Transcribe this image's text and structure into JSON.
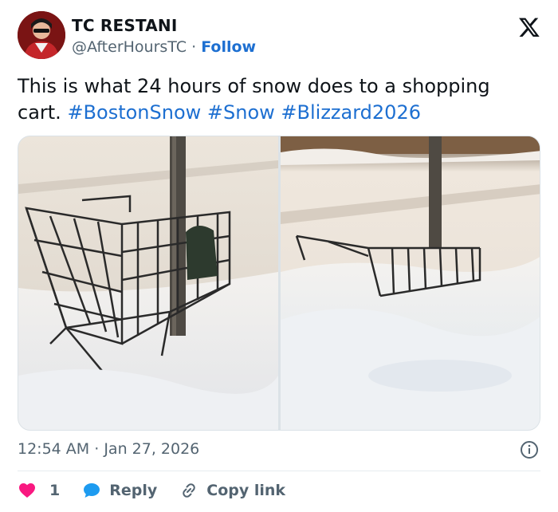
{
  "author": {
    "name": "TC RESTANI",
    "handle": "@AfterHoursTC",
    "separator": "·",
    "follow_label": "Follow"
  },
  "tweet": {
    "text": "This is what 24 hours of snow does to a shopping cart. ",
    "hashtags": [
      "#BostonSnow",
      "#Snow",
      "#Blizzard2026"
    ]
  },
  "media": [
    {
      "icon": "photo-shopping-cart-upright-in-snow"
    },
    {
      "icon": "photo-shopping-cart-buried-in-snow"
    }
  ],
  "meta": {
    "time": "12:54 AM",
    "separator": "·",
    "date": "Jan 27, 2026"
  },
  "actions": {
    "like_count": "1",
    "reply_label": "Reply",
    "copy_label": "Copy link"
  },
  "colors": {
    "link": "#1d6fd1",
    "like": "#f91880",
    "reply_bubble": "#1d9bf0",
    "muted": "#536471"
  }
}
